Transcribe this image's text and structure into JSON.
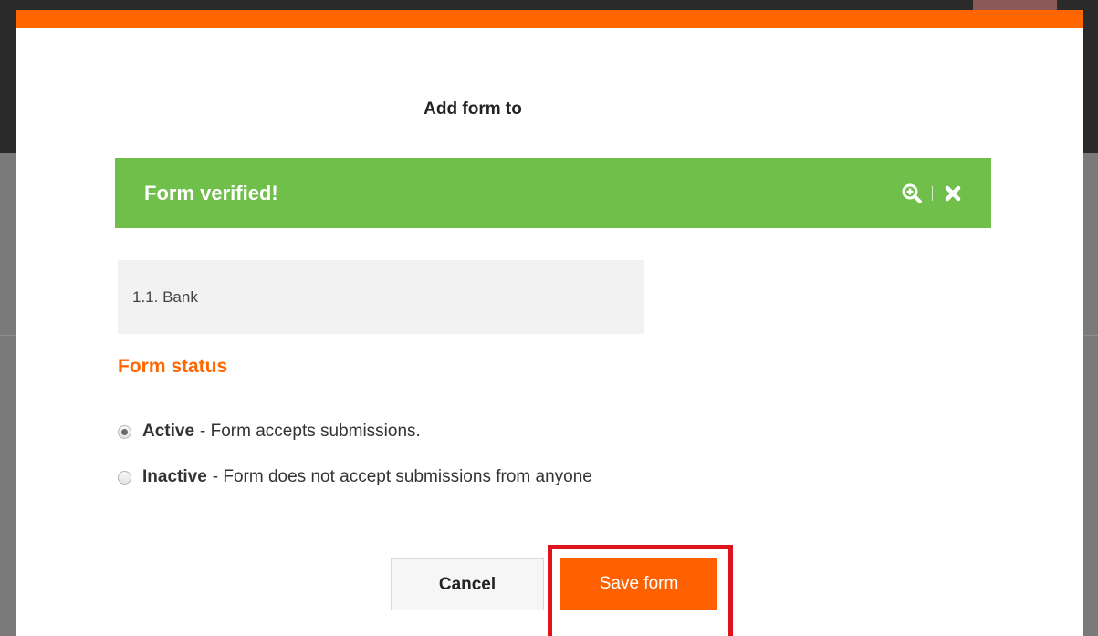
{
  "modal": {
    "title": "Add form to",
    "banner": {
      "text": "Form verified!",
      "zoom_icon": "zoom-in-icon",
      "close_icon": "close-icon"
    },
    "form_name": "1.1. Bank",
    "status_heading": "Form status",
    "options": [
      {
        "label": "Active",
        "description": "- Form accepts submissions.",
        "checked": true
      },
      {
        "label": "Inactive",
        "description": "- Form does not accept submissions from anyone",
        "checked": false
      }
    ],
    "cancel_label": "Cancel",
    "save_label": "Save form"
  },
  "colors": {
    "accent": "#ff6600",
    "banner": "#70bf4b",
    "highlight": "#e0121b"
  }
}
